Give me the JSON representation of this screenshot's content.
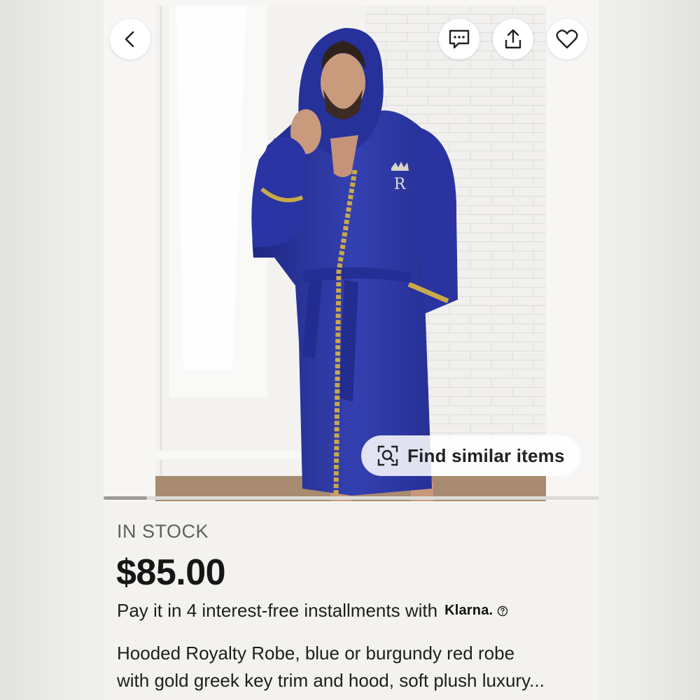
{
  "nav": {
    "back_icon": "chevron-left-icon",
    "actions": [
      "message-icon",
      "share-icon",
      "heart-icon"
    ]
  },
  "gallery": {
    "find_similar_label": "Find similar items",
    "find_similar_icon": "visual-search-icon",
    "robe_monogram": "R",
    "current_image": 1
  },
  "product": {
    "stock_status": "IN STOCK",
    "price": "$85.00",
    "installments_text": "Pay it in 4 interest-free installments with",
    "installments_provider": "Klarna.",
    "description_line1": "Hooded Royalty Robe, blue or burgundy red robe",
    "description_line2": "with gold greek key trim and hood, soft plush luxury..."
  },
  "colors": {
    "robe_blue": "#2a35a0",
    "trim_gold": "#c9a94a",
    "page_background": "#f4f2ef"
  }
}
